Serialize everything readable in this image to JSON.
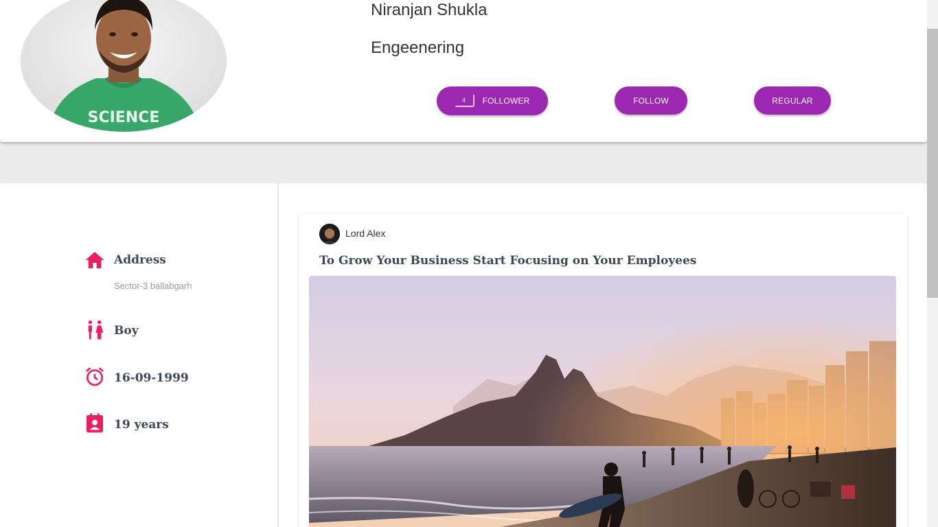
{
  "profile": {
    "name": "Niranjan Shukla",
    "department": "Engeenering",
    "follower_count": "4",
    "follower_label": "FOLLOWER",
    "follow_label": "FOLLOW",
    "regular_label": "REGULAR"
  },
  "info": {
    "address_label": "Address",
    "address_value": "Sector-3 ballabgarh",
    "gender": "Boy",
    "dob": "16-09-1999",
    "age": "19 years"
  },
  "post": {
    "author": "Lord Alex",
    "title": "To Grow Your Business Start Focusing on Your Employees"
  },
  "theme": {
    "accent": "#9c27b0",
    "icon_color": "#e91e63"
  },
  "icons": {
    "address": "home-icon",
    "gender": "wc-icon",
    "dob": "alarm-icon",
    "age": "contact-card-icon"
  }
}
